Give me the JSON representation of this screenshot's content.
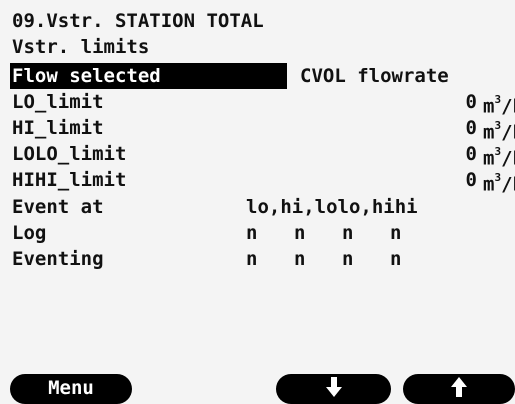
{
  "header": {
    "title": "09.Vstr. STATION TOTAL",
    "subtitle": "Vstr. limits"
  },
  "selected": {
    "label": "Flow selected",
    "value": "CVOL flowrate"
  },
  "limits": [
    {
      "label": "LO_limit",
      "value": "0",
      "unit": "m",
      "unit_sup": "3",
      "unit_rest": "/h"
    },
    {
      "label": "HI_limit",
      "value": "0",
      "unit": "m",
      "unit_sup": "3",
      "unit_rest": "/h"
    },
    {
      "label": "LOLO_limit",
      "value": "0",
      "unit": "m",
      "unit_sup": "3",
      "unit_rest": "/h"
    },
    {
      "label": "HIHI_limit",
      "value": "0",
      "unit": "m",
      "unit_sup": "3",
      "unit_rest": "/h"
    }
  ],
  "event": {
    "label": "Event at",
    "value": "lo,hi,lolo,hihi"
  },
  "log": {
    "label": "Log",
    "flags": [
      "n",
      "n",
      "n",
      "n"
    ]
  },
  "eventing": {
    "label": "Eventing",
    "flags": [
      "n",
      "n",
      "n",
      "n"
    ]
  },
  "softkeys": {
    "menu": "Menu",
    "down_icon": "arrow-down-icon",
    "up_icon": "arrow-up-icon"
  }
}
